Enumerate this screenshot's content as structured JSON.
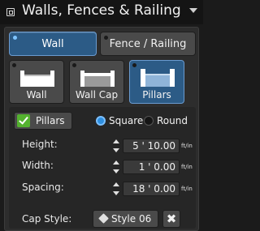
{
  "header": {
    "title": "Walls, Fences & Railing",
    "icon": "window-icon"
  },
  "tabs": [
    {
      "label": "Wall",
      "active": true
    },
    {
      "label": "Fence / Railing",
      "active": false
    }
  ],
  "types": [
    {
      "label": "Wall",
      "icon": "wall-icon",
      "active": false
    },
    {
      "label": "Wall Cap",
      "icon": "wall-cap-icon",
      "active": false
    },
    {
      "label": "Pillars",
      "icon": "pillars-icon",
      "active": true
    }
  ],
  "options": {
    "pillars": {
      "label": "Pillars",
      "checked": true
    },
    "shape": {
      "selected": "Square",
      "square_label": "Square",
      "round_label": "Round"
    },
    "height": {
      "label": "Height:",
      "value": "5 ' 10.00",
      "unit": "ft/in"
    },
    "width": {
      "label": "Width:",
      "value": "1 ' 0.00",
      "unit": "ft/in"
    },
    "spacing": {
      "label": "Spacing:",
      "value": "18 ' 0.00",
      "unit": "ft/in"
    },
    "cap_style": {
      "label": "Cap Style:",
      "value": "Style 06",
      "clear_glyph": "✖"
    }
  },
  "colors": {
    "accent": "#2c5b86",
    "check": "#54b22f",
    "radio": "#2e8fe0"
  }
}
